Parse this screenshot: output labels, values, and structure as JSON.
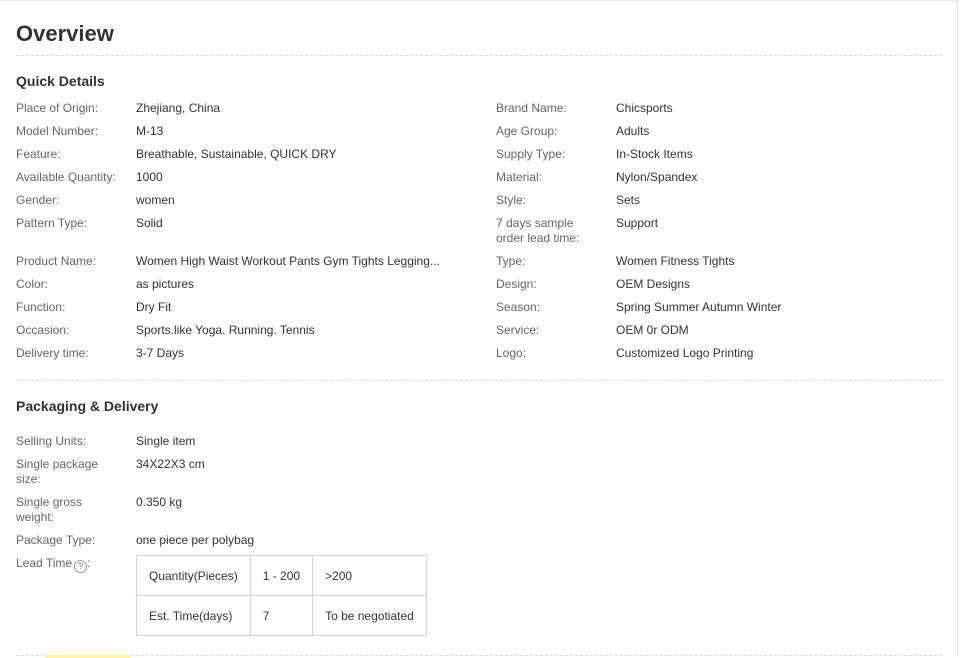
{
  "title": "Overview",
  "quick_details": {
    "heading": "Quick Details",
    "left": [
      {
        "label": "Place of Origin:",
        "value": "Zhejiang, China"
      },
      {
        "label": "Model Number:",
        "value": "M-13"
      },
      {
        "label": "Feature:",
        "value": "Breathable, Sustainable, QUICK DRY"
      },
      {
        "label": "Available Quantity:",
        "value": "1000"
      },
      {
        "label": "Gender:",
        "value": "women"
      },
      {
        "label": "Pattern Type:",
        "value": "Solid"
      },
      {
        "label": "Product Name:",
        "value": "Women High Waist Workout Pants Gym Tights Legging..."
      },
      {
        "label": "Color:",
        "value": "as pictures"
      },
      {
        "label": "Function:",
        "value": "Dry Fit"
      },
      {
        "label": "Occasion:",
        "value": "Sports.like Yoga. Running. Tennis"
      },
      {
        "label": "Delivery time:",
        "value": "3-7 Days"
      }
    ],
    "right": [
      {
        "label": "Brand Name:",
        "value": "Chicsports"
      },
      {
        "label": "Age Group:",
        "value": "Adults"
      },
      {
        "label": "Supply Type:",
        "value": "In-Stock Items"
      },
      {
        "label": "Material:",
        "value": "Nylon/Spandex"
      },
      {
        "label": "Style:",
        "value": "Sets"
      },
      {
        "label": "7 days sample order lead time:",
        "value": "Support"
      },
      {
        "label": "Type:",
        "value": "Women Fitness Tights"
      },
      {
        "label": "Design:",
        "value": "OEM Designs"
      },
      {
        "label": "Season:",
        "value": "Spring Summer Autumn Winter"
      },
      {
        "label": "Service:",
        "value": "OEM 0r ODM"
      },
      {
        "label": "Logo:",
        "value": "Customized Logo Printing"
      }
    ]
  },
  "packaging": {
    "heading": "Packaging & Delivery",
    "rows": [
      {
        "label": "Selling Units:",
        "value": "Single item"
      },
      {
        "label": "Single package size:",
        "value": "34X22X3 cm"
      },
      {
        "label": "Single gross weight:",
        "value": "0.350 kg"
      },
      {
        "label": "Package Type:",
        "value": "one piece per polybag"
      }
    ],
    "lead_time": {
      "label": "Lead Time",
      "help_icon_glyph": "?",
      "rows": [
        [
          "Quantity(Pieces)",
          "1 - 200",
          ">200"
        ],
        [
          "Est. Time(days)",
          "7",
          "To be negotiated"
        ]
      ]
    }
  }
}
